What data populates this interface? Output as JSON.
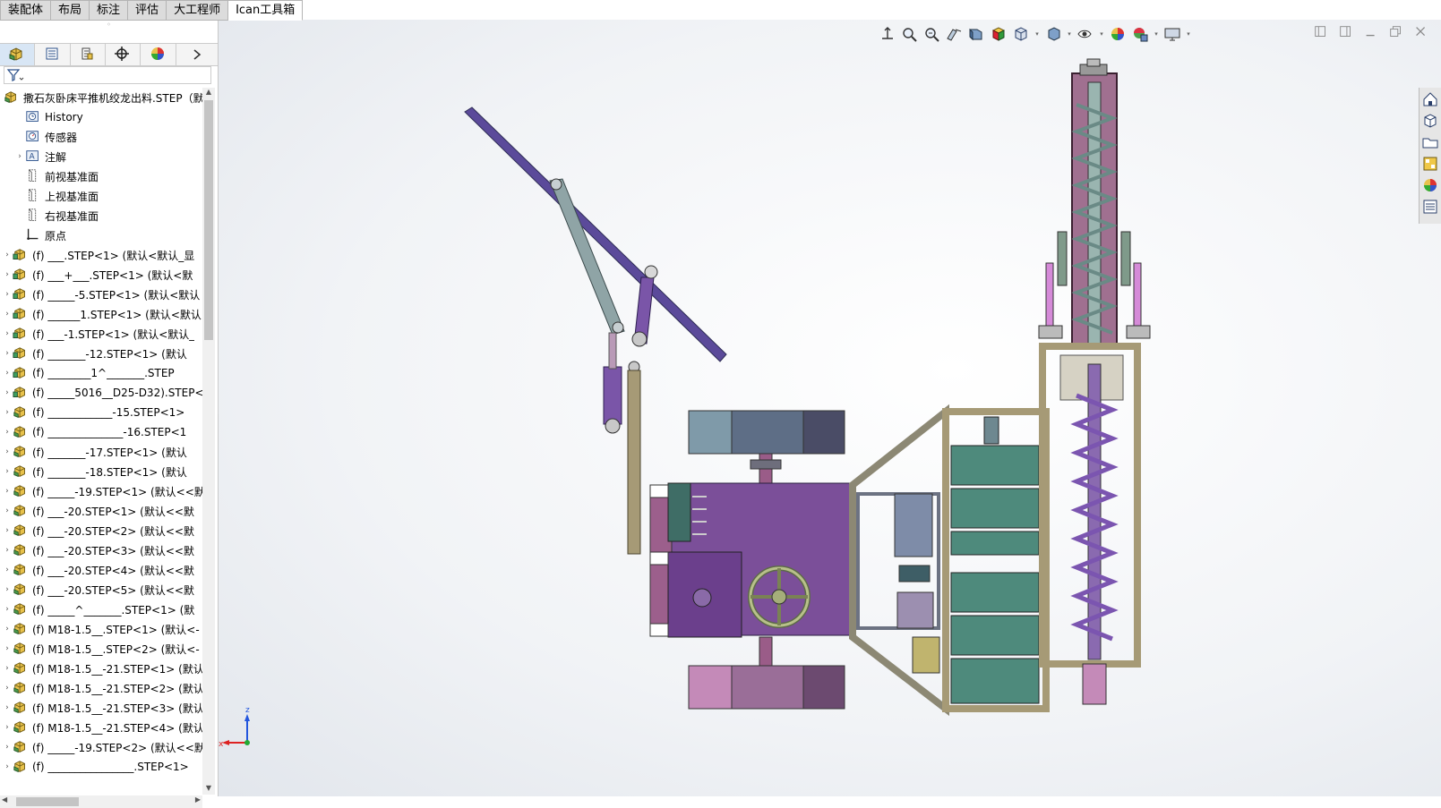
{
  "tabs": [
    {
      "label": "装配体",
      "active": false
    },
    {
      "label": "布局",
      "active": false
    },
    {
      "label": "标注",
      "active": false
    },
    {
      "label": "评估",
      "active": false
    },
    {
      "label": "大工程师",
      "active": false
    },
    {
      "label": "Ican工具箱",
      "active": true
    }
  ],
  "manager_tabs": [
    {
      "name": "featuremanager-tab",
      "icon": "assembly-icon"
    },
    {
      "name": "propertymanager-tab",
      "icon": "property-list-icon"
    },
    {
      "name": "configurationmanager-tab",
      "icon": "configuration-icon"
    },
    {
      "name": "dimxpert-tab",
      "icon": "crosshair-icon"
    },
    {
      "name": "display-manager-tab",
      "icon": "color-wheel-icon"
    }
  ],
  "filter": {
    "icon": "funnel-icon"
  },
  "tree": [
    {
      "label": "撒石灰卧床平推机绞龙出料.STEP（默",
      "type": "root",
      "expand": ""
    },
    {
      "label": "History",
      "type": "history",
      "expand": ""
    },
    {
      "label": "传感器",
      "type": "sensor",
      "expand": ""
    },
    {
      "label": "注解",
      "type": "annotation",
      "expand": "›"
    },
    {
      "label": "前视基准面",
      "type": "plane",
      "expand": ""
    },
    {
      "label": "上视基准面",
      "type": "plane",
      "expand": ""
    },
    {
      "label": "右视基准面",
      "type": "plane",
      "expand": ""
    },
    {
      "label": "原点",
      "type": "origin",
      "expand": ""
    },
    {
      "label": "(f) ___.STEP<1> (默认<默认_显",
      "type": "part",
      "expand": "›"
    },
    {
      "label": "(f) ___+___.STEP<1> (默认<默",
      "type": "part",
      "expand": "›"
    },
    {
      "label": "(f) _____-5.STEP<1> (默认<默认",
      "type": "part",
      "expand": "›"
    },
    {
      "label": "(f) ______1.STEP<1> (默认<默认",
      "type": "part",
      "expand": "›"
    },
    {
      "label": "(f) ___-1.STEP<1> (默认<默认_",
      "type": "part",
      "expand": "›"
    },
    {
      "label": "(f) _______-12.STEP<1> (默认",
      "type": "part",
      "expand": "›"
    },
    {
      "label": "(f) ________1^_______.STEP",
      "type": "part",
      "expand": "›"
    },
    {
      "label": "(f) _____5016__D25-D32).STEP<",
      "type": "part",
      "expand": "›"
    },
    {
      "label": "(f) ____________-15.STEP<1>",
      "type": "asm",
      "expand": "›"
    },
    {
      "label": "(f) ______________-16.STEP<1",
      "type": "asm",
      "expand": "›"
    },
    {
      "label": "(f) _______-17.STEP<1> (默认",
      "type": "asm",
      "expand": "›"
    },
    {
      "label": "(f) _______-18.STEP<1> (默认",
      "type": "asm",
      "expand": "›"
    },
    {
      "label": "(f) _____-19.STEP<1> (默认<<默",
      "type": "asm",
      "expand": "›"
    },
    {
      "label": "(f) ___-20.STEP<1> (默认<<默",
      "type": "asm",
      "expand": "›"
    },
    {
      "label": "(f) ___-20.STEP<2> (默认<<默",
      "type": "asm",
      "expand": "›"
    },
    {
      "label": "(f) ___-20.STEP<3> (默认<<默",
      "type": "asm",
      "expand": "›"
    },
    {
      "label": "(f) ___-20.STEP<4> (默认<<默",
      "type": "asm",
      "expand": "›"
    },
    {
      "label": "(f) ___-20.STEP<5> (默认<<默",
      "type": "asm",
      "expand": "›"
    },
    {
      "label": "(f) _____^_______.STEP<1> (默",
      "type": "asm",
      "expand": "›"
    },
    {
      "label": "(f) M18-1.5__.STEP<1> (默认<-",
      "type": "asm",
      "expand": "›"
    },
    {
      "label": "(f) M18-1.5__.STEP<2> (默认<-",
      "type": "asm",
      "expand": "›"
    },
    {
      "label": "(f) M18-1.5__-21.STEP<1> (默认",
      "type": "asm",
      "expand": "›"
    },
    {
      "label": "(f) M18-1.5__-21.STEP<2> (默认",
      "type": "asm",
      "expand": "›"
    },
    {
      "label": "(f) M18-1.5__-21.STEP<3> (默认",
      "type": "asm",
      "expand": "›"
    },
    {
      "label": "(f) M18-1.5__-21.STEP<4> (默认",
      "type": "asm",
      "expand": "›"
    },
    {
      "label": "(f) _____-19.STEP<2> (默认<<默",
      "type": "asm",
      "expand": "›"
    },
    {
      "label": "(f) ________________.STEP<1>",
      "type": "asm",
      "expand": "›"
    }
  ],
  "headsup_toolbar": [
    {
      "name": "zoom-to-fit-icon",
      "dd": false
    },
    {
      "name": "zoom-to-area-icon",
      "dd": false
    },
    {
      "name": "previous-view-icon",
      "dd": false
    },
    {
      "name": "section-view-icon",
      "dd": false
    },
    {
      "name": "dynamic-annotation-icon",
      "dd": false
    },
    {
      "name": "view-orientation-icon",
      "dd": false
    },
    {
      "name": "display-style-icon",
      "dd": true
    },
    {
      "name": "hide-show-items-icon",
      "dd": true
    },
    {
      "name": "edit-appearance-icon",
      "dd": true
    },
    {
      "name": "apply-scene-icon",
      "dd": false
    },
    {
      "name": "view-settings-icon",
      "dd": true
    },
    {
      "name": "display-monitor-icon",
      "dd": true
    }
  ],
  "window_controls": [
    "tile-left-icon",
    "tile-right-icon",
    "minimize-icon",
    "restore-icon",
    "close-icon"
  ],
  "task_pane": [
    "home-icon",
    "3d-parts-icon",
    "file-explorer-icon",
    "view-palette-icon",
    "appearances-icon",
    "custom-properties-icon"
  ],
  "triad": {
    "z_label": "z",
    "x_label": "x"
  },
  "colors": {
    "purple": "#7b4f99",
    "teal": "#4e8a7c",
    "tan": "#a69a76",
    "steel": "#8f9ab0"
  }
}
